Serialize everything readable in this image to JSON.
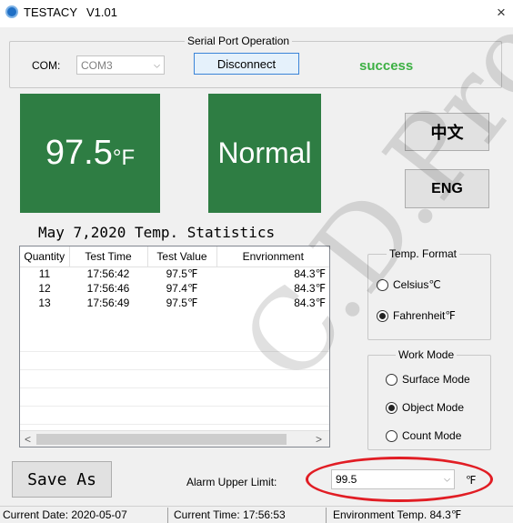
{
  "app": {
    "title": "TESTACY",
    "version": "V1.01",
    "close": "×"
  },
  "serial": {
    "group_label": "Serial Port Operation",
    "com_label": "COM:",
    "com_value": "COM3",
    "disconnect_label": "Disconnect",
    "status": "success"
  },
  "display": {
    "temperature": "97.5",
    "temperature_unit": "°F",
    "status": "Normal"
  },
  "language": {
    "chinese": "中文",
    "english": "ENG"
  },
  "stats": {
    "title": "May 7,2020 Temp. Statistics",
    "columns": [
      "Quantity",
      "Test Time",
      "Test Value",
      "Envrionment"
    ],
    "rows": [
      {
        "quantity": "11",
        "time": "17:56:42",
        "value": "97.5℉",
        "env": "84.3℉"
      },
      {
        "quantity": "12",
        "time": "17:56:46",
        "value": "97.4℉",
        "env": "84.3℉"
      },
      {
        "quantity": "13",
        "time": "17:56:49",
        "value": "97.5℉",
        "env": "84.3℉"
      }
    ],
    "scroll_left": "<",
    "scroll_right": ">"
  },
  "temp_format": {
    "label": "Temp. Format",
    "celsius": "Celsius℃",
    "fahrenheit": "Fahrenheit℉",
    "selected": "fahrenheit"
  },
  "work_mode": {
    "label": "Work Mode",
    "surface": "Surface Mode",
    "object": "Object Mode",
    "count": "Count Mode",
    "selected": "object"
  },
  "bottom": {
    "save_as": "Save As",
    "alarm_label": "Alarm Upper Limit:",
    "alarm_value": "99.5",
    "alarm_unit": "℉"
  },
  "statusbar": {
    "current_date": "Current Date:  2020-05-07",
    "current_time": "Current Time:  17:56:53",
    "environment": "Environment Temp.  84.3℉"
  },
  "watermark": "C.D.Pro",
  "colors": {
    "panel_green": "#2e7d43",
    "success_green": "#3cb043",
    "highlight_red": "#e11d24"
  }
}
